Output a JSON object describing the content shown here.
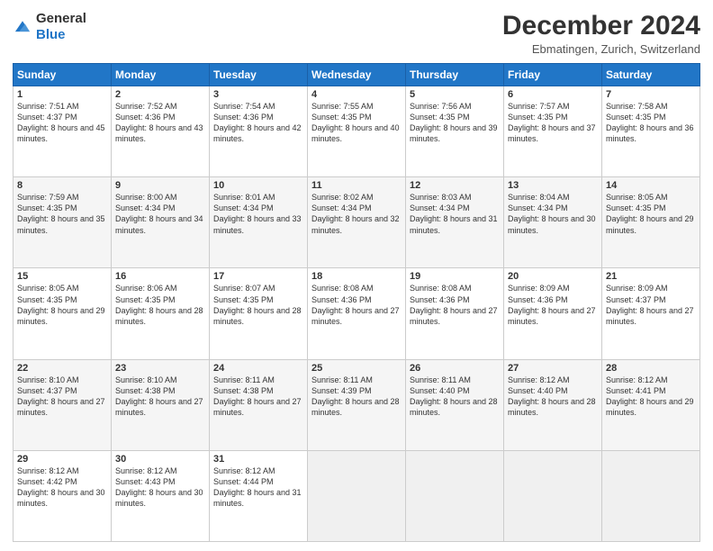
{
  "header": {
    "logo_general": "General",
    "logo_blue": "Blue",
    "month_title": "December 2024",
    "location": "Ebmatingen, Zurich, Switzerland"
  },
  "weekdays": [
    "Sunday",
    "Monday",
    "Tuesday",
    "Wednesday",
    "Thursday",
    "Friday",
    "Saturday"
  ],
  "weeks": [
    [
      {
        "day": "1",
        "sunrise": "7:51 AM",
        "sunset": "4:37 PM",
        "daylight": "8 hours and 45 minutes."
      },
      {
        "day": "2",
        "sunrise": "7:52 AM",
        "sunset": "4:36 PM",
        "daylight": "8 hours and 43 minutes."
      },
      {
        "day": "3",
        "sunrise": "7:54 AM",
        "sunset": "4:36 PM",
        "daylight": "8 hours and 42 minutes."
      },
      {
        "day": "4",
        "sunrise": "7:55 AM",
        "sunset": "4:35 PM",
        "daylight": "8 hours and 40 minutes."
      },
      {
        "day": "5",
        "sunrise": "7:56 AM",
        "sunset": "4:35 PM",
        "daylight": "8 hours and 39 minutes."
      },
      {
        "day": "6",
        "sunrise": "7:57 AM",
        "sunset": "4:35 PM",
        "daylight": "8 hours and 37 minutes."
      },
      {
        "day": "7",
        "sunrise": "7:58 AM",
        "sunset": "4:35 PM",
        "daylight": "8 hours and 36 minutes."
      }
    ],
    [
      {
        "day": "8",
        "sunrise": "7:59 AM",
        "sunset": "4:35 PM",
        "daylight": "8 hours and 35 minutes."
      },
      {
        "day": "9",
        "sunrise": "8:00 AM",
        "sunset": "4:34 PM",
        "daylight": "8 hours and 34 minutes."
      },
      {
        "day": "10",
        "sunrise": "8:01 AM",
        "sunset": "4:34 PM",
        "daylight": "8 hours and 33 minutes."
      },
      {
        "day": "11",
        "sunrise": "8:02 AM",
        "sunset": "4:34 PM",
        "daylight": "8 hours and 32 minutes."
      },
      {
        "day": "12",
        "sunrise": "8:03 AM",
        "sunset": "4:34 PM",
        "daylight": "8 hours and 31 minutes."
      },
      {
        "day": "13",
        "sunrise": "8:04 AM",
        "sunset": "4:34 PM",
        "daylight": "8 hours and 30 minutes."
      },
      {
        "day": "14",
        "sunrise": "8:05 AM",
        "sunset": "4:35 PM",
        "daylight": "8 hours and 29 minutes."
      }
    ],
    [
      {
        "day": "15",
        "sunrise": "8:05 AM",
        "sunset": "4:35 PM",
        "daylight": "8 hours and 29 minutes."
      },
      {
        "day": "16",
        "sunrise": "8:06 AM",
        "sunset": "4:35 PM",
        "daylight": "8 hours and 28 minutes."
      },
      {
        "day": "17",
        "sunrise": "8:07 AM",
        "sunset": "4:35 PM",
        "daylight": "8 hours and 28 minutes."
      },
      {
        "day": "18",
        "sunrise": "8:08 AM",
        "sunset": "4:36 PM",
        "daylight": "8 hours and 27 minutes."
      },
      {
        "day": "19",
        "sunrise": "8:08 AM",
        "sunset": "4:36 PM",
        "daylight": "8 hours and 27 minutes."
      },
      {
        "day": "20",
        "sunrise": "8:09 AM",
        "sunset": "4:36 PM",
        "daylight": "8 hours and 27 minutes."
      },
      {
        "day": "21",
        "sunrise": "8:09 AM",
        "sunset": "4:37 PM",
        "daylight": "8 hours and 27 minutes."
      }
    ],
    [
      {
        "day": "22",
        "sunrise": "8:10 AM",
        "sunset": "4:37 PM",
        "daylight": "8 hours and 27 minutes."
      },
      {
        "day": "23",
        "sunrise": "8:10 AM",
        "sunset": "4:38 PM",
        "daylight": "8 hours and 27 minutes."
      },
      {
        "day": "24",
        "sunrise": "8:11 AM",
        "sunset": "4:38 PM",
        "daylight": "8 hours and 27 minutes."
      },
      {
        "day": "25",
        "sunrise": "8:11 AM",
        "sunset": "4:39 PM",
        "daylight": "8 hours and 28 minutes."
      },
      {
        "day": "26",
        "sunrise": "8:11 AM",
        "sunset": "4:40 PM",
        "daylight": "8 hours and 28 minutes."
      },
      {
        "day": "27",
        "sunrise": "8:12 AM",
        "sunset": "4:40 PM",
        "daylight": "8 hours and 28 minutes."
      },
      {
        "day": "28",
        "sunrise": "8:12 AM",
        "sunset": "4:41 PM",
        "daylight": "8 hours and 29 minutes."
      }
    ],
    [
      {
        "day": "29",
        "sunrise": "8:12 AM",
        "sunset": "4:42 PM",
        "daylight": "8 hours and 30 minutes."
      },
      {
        "day": "30",
        "sunrise": "8:12 AM",
        "sunset": "4:43 PM",
        "daylight": "8 hours and 30 minutes."
      },
      {
        "day": "31",
        "sunrise": "8:12 AM",
        "sunset": "4:44 PM",
        "daylight": "8 hours and 31 minutes."
      },
      null,
      null,
      null,
      null
    ]
  ]
}
